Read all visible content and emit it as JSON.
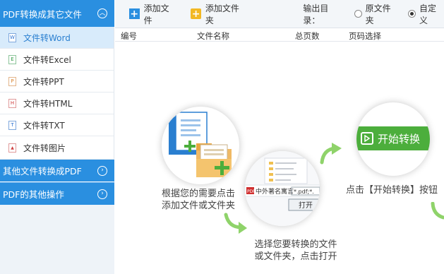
{
  "sidebar": {
    "sections": [
      {
        "label": "PDF转换成其它文件",
        "chevron": "up"
      },
      {
        "label": "其他文件转换成PDF",
        "chevron": "right"
      },
      {
        "label": "PDF的其他操作",
        "chevron": "right"
      }
    ],
    "items": [
      {
        "label": "文件转Word",
        "icon": "word-file-icon",
        "glyph": "W",
        "color": "#2a6fd0"
      },
      {
        "label": "文件转Excel",
        "icon": "excel-file-icon",
        "glyph": "E",
        "color": "#2e9a42"
      },
      {
        "label": "文件转PPT",
        "icon": "ppt-file-icon",
        "glyph": "P",
        "color": "#d9822b"
      },
      {
        "label": "文件转HTML",
        "icon": "html-file-icon",
        "glyph": "H",
        "color": "#d04040"
      },
      {
        "label": "文件转TXT",
        "icon": "txt-file-icon",
        "glyph": "T",
        "color": "#2a6fd0"
      },
      {
        "label": "文件转图片",
        "icon": "image-file-icon",
        "glyph": "▲",
        "color": "#d04040"
      }
    ]
  },
  "toolbar": {
    "add_file": "添加文件",
    "add_folder": "添加文件夹",
    "output_label": "输出目录：",
    "radio_original": "原文件夹",
    "radio_custom": "自定义"
  },
  "table": {
    "columns": [
      "编号",
      "文件名称",
      "总页数",
      "页码选择"
    ]
  },
  "steps": {
    "step1": [
      "根据您的需要点击",
      "添加文件或文件夹"
    ],
    "step2": [
      "选择您要转换的文件",
      "或文件夹，点击打开"
    ],
    "step3": "点击【开始转换】按钮",
    "dialog_filetype": "中外著名寓言",
    "dialog_filter": "*.pdf;*.",
    "dialog_open": "打开",
    "start_button": "开始转换"
  },
  "colors": {
    "accent_blue": "#2a8fe0",
    "active_bg": "#d8ebfb",
    "green": "#4cae3c",
    "arrow_green": "#8fd36a"
  }
}
